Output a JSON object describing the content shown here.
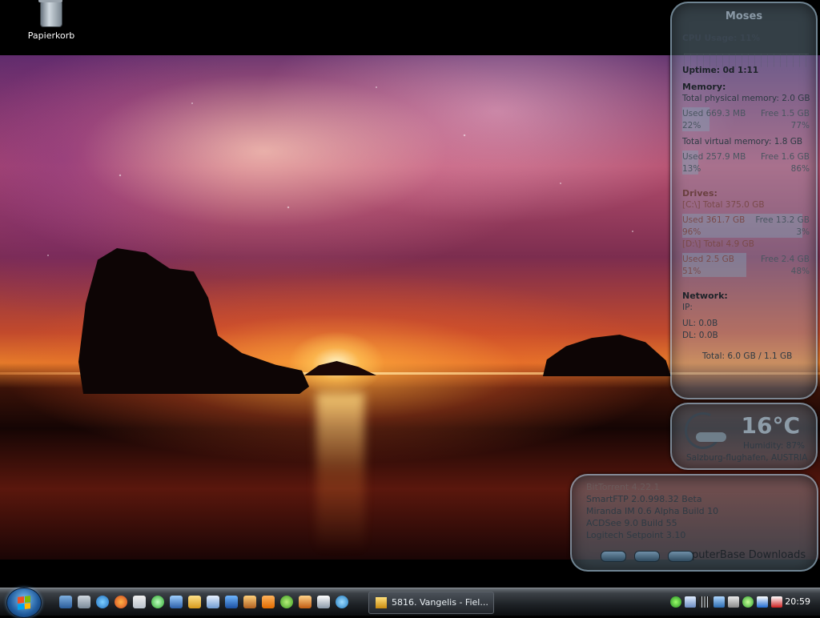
{
  "desktop": {
    "icons": [
      {
        "label": "Papierkorb",
        "icon": "recycle-bin-icon"
      }
    ]
  },
  "sysmon": {
    "title": "Moses",
    "cpu": "CPU Usage: 11%",
    "uptime": "Uptime: 0d 1:11",
    "memory_header": "Memory:",
    "total_physical": "Total physical memory: 2.0 GB",
    "phys_used": "Used 669.3 MB",
    "phys_free": "Free 1.5 GB",
    "phys_used_pct": "22%",
    "phys_free_pct": "77%",
    "total_virtual": "Total virtual memory: 1.8 GB",
    "virt_used": "Used 257.9 MB",
    "virt_free": "Free 1.6 GB",
    "virt_used_pct": "13%",
    "virt_free_pct": "86%",
    "drives_header": "Drives:",
    "drive_c": "[C:\\] Total 375.0 GB",
    "c_used": "Used 361.7 GB",
    "c_free": "Free 13.2 GB",
    "c_used_pct": "96%",
    "c_free_pct": "3%",
    "drive_d": "[D:\\] Total 4.9 GB",
    "d_used": "Used 2.5 GB",
    "d_free": "Free 2.4 GB",
    "d_used_pct": "51%",
    "d_free_pct": "48%",
    "network_header": "Network:",
    "ip": "IP:",
    "ul": "UL: 0.0B",
    "dl": "DL: 0.0B",
    "net_total": "Total: 6.0 GB / 1.1 GB"
  },
  "weather": {
    "temp": "16°C",
    "humidity": "Humidity: 87%",
    "location": "Salzburg-flughafen, AUSTRIA",
    "icon": "moon-cloud-icon"
  },
  "apps": {
    "items": [
      "BitTorrent 4.22.1",
      "SmartFTP 2.0.998.32 Beta",
      "Miranda IM 0.6 Alpha Build 10",
      "ACDSee 9.0 Build 55",
      "Logitech Setpoint 3.10"
    ],
    "footer": "puterBase Downloads"
  },
  "taskbar": {
    "task_label": "5816. Vangelis - Fiel...",
    "clock": "20:59"
  },
  "colors": {
    "taskbar": "#1d2125",
    "widget_glass": "#96b4c8",
    "start_orb": "#1f5a9c"
  }
}
